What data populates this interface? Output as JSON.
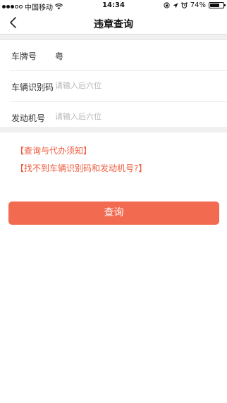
{
  "status_bar": {
    "carrier": "中国移动",
    "time": "14:34",
    "battery_text": "74%",
    "battery_level": 0.74,
    "signal_bars": 3,
    "icons": [
      "wifi-icon",
      "lock-rotation-icon",
      "location-arrow-icon",
      "alarm-icon"
    ]
  },
  "nav": {
    "title": "违章查询",
    "back_icon": "chevron-left-icon"
  },
  "form": {
    "plate": {
      "label": "车牌号",
      "value": "粤"
    },
    "vin": {
      "label": "车辆识别码",
      "placeholder": "请输入后六位",
      "value": ""
    },
    "engine": {
      "label": "发动机号",
      "placeholder": "请输入后六位",
      "value": ""
    }
  },
  "links": {
    "notice": "【查询与代办须知】",
    "help": "【找不到车辆识别码和发动机号?】"
  },
  "submit": {
    "label": "查询"
  },
  "colors": {
    "accent": "#f26a50",
    "link": "#ef5b3e",
    "separator": "#f0f0f0"
  }
}
